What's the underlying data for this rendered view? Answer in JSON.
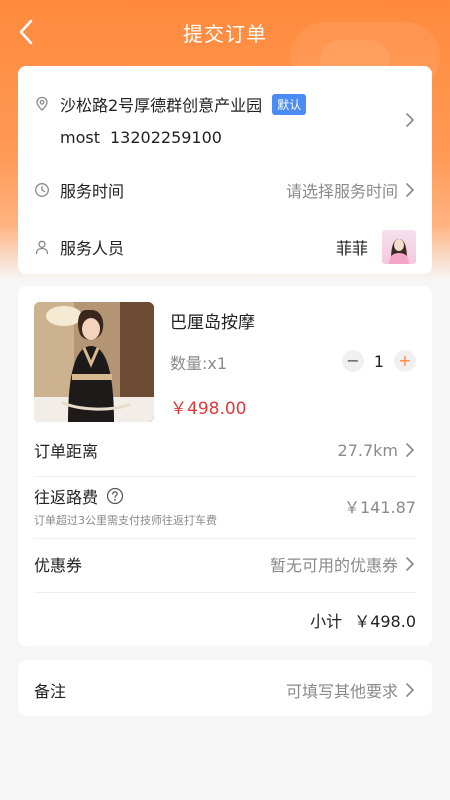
{
  "header": {
    "title": "提交订单"
  },
  "address": {
    "line": "沙松路2号厚德群创意产业园",
    "badge": "默认",
    "name": "most",
    "phone": "13202259100"
  },
  "service_time": {
    "label": "服务时间",
    "placeholder": "请选择服务时间"
  },
  "staff": {
    "label": "服务人员",
    "name": "菲菲"
  },
  "product": {
    "name": "巴厘岛按摩",
    "qty_label": "数量:x1",
    "price": "￥498.00",
    "quantity": "1",
    "minus": "−",
    "plus": "+"
  },
  "order_distance": {
    "label": "订单距离",
    "value": "27.7km"
  },
  "round_trip_fare": {
    "label": "往返路费",
    "note": "订单超过3公里需支付技师往返打车费",
    "value": "￥141.87"
  },
  "coupon": {
    "label": "优惠券",
    "value": "暂无可用的优惠券"
  },
  "subtotal": {
    "label": "小计",
    "value": "￥498.0"
  },
  "remark": {
    "label": "备注",
    "placeholder": "可填写其他要求"
  },
  "colors": {
    "accent": "#ff8a3c",
    "price": "#e03a3a",
    "badge": "#4a8bf5"
  }
}
